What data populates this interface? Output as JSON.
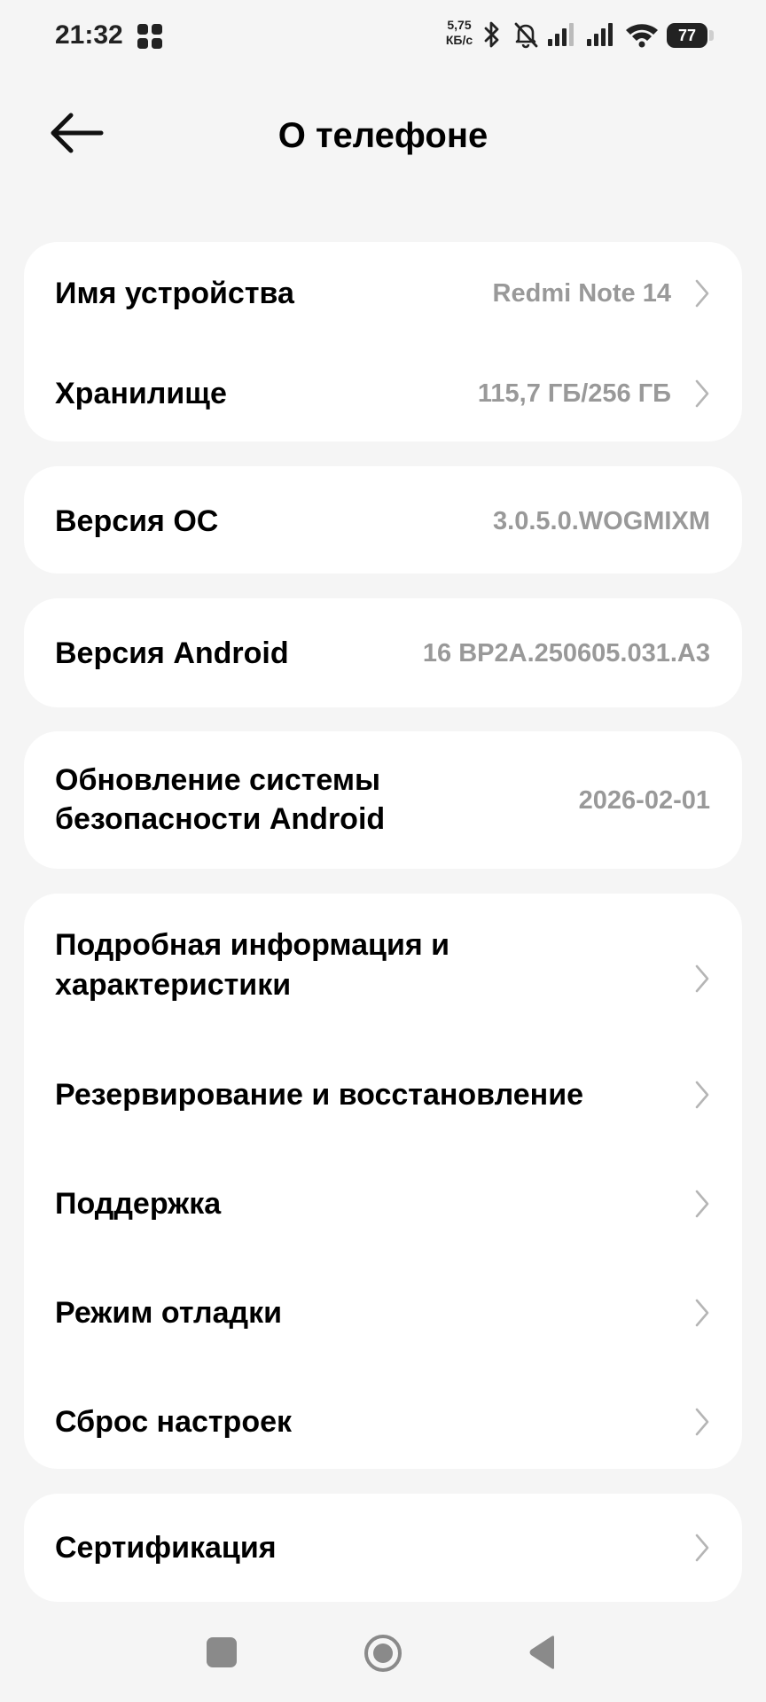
{
  "status_bar": {
    "time": "21:32",
    "network_speed_value": "5,75",
    "network_speed_unit": "КБ/с",
    "battery_level": "77",
    "icons": [
      "app-grid-icon",
      "bluetooth-icon",
      "bell-off-icon",
      "signal-icon",
      "signal-icon",
      "wifi-icon",
      "battery-icon"
    ]
  },
  "header": {
    "title": "О телефоне",
    "back_icon": "arrow-left-icon"
  },
  "card_device": {
    "device_name_label": "Имя устройства",
    "device_name_value": "Redmi Note 14",
    "storage_label": "Хранилище",
    "storage_value": "115,7 ГБ/256 ГБ"
  },
  "card_os": {
    "label": "Версия ОС",
    "value": "3.0.5.0.WOGMIXM"
  },
  "card_android": {
    "label": "Версия Android",
    "value": "16 BP2A.250605.031.A3"
  },
  "card_security": {
    "label_line1": "Обновление системы",
    "label_line2": "безопасности Android",
    "value": "2026-02-01"
  },
  "card_menu": {
    "details_line1": "Подробная информация и",
    "details_line2": "характеристики",
    "backup": "Резервирование и восстановление",
    "support": "Поддержка",
    "debug": "Режим отладки",
    "reset": "Сброс настроек"
  },
  "card_cert": {
    "label": "Сертификация"
  },
  "nav_bar": {
    "icons": [
      "square-recents-icon",
      "circle-home-icon",
      "triangle-back-icon"
    ]
  },
  "colors": {
    "background": "#f5f5f5",
    "card": "#ffffff",
    "value_text": "#999999",
    "chevron": "#b5b5b5",
    "nav_icon": "#8a8a8a"
  }
}
